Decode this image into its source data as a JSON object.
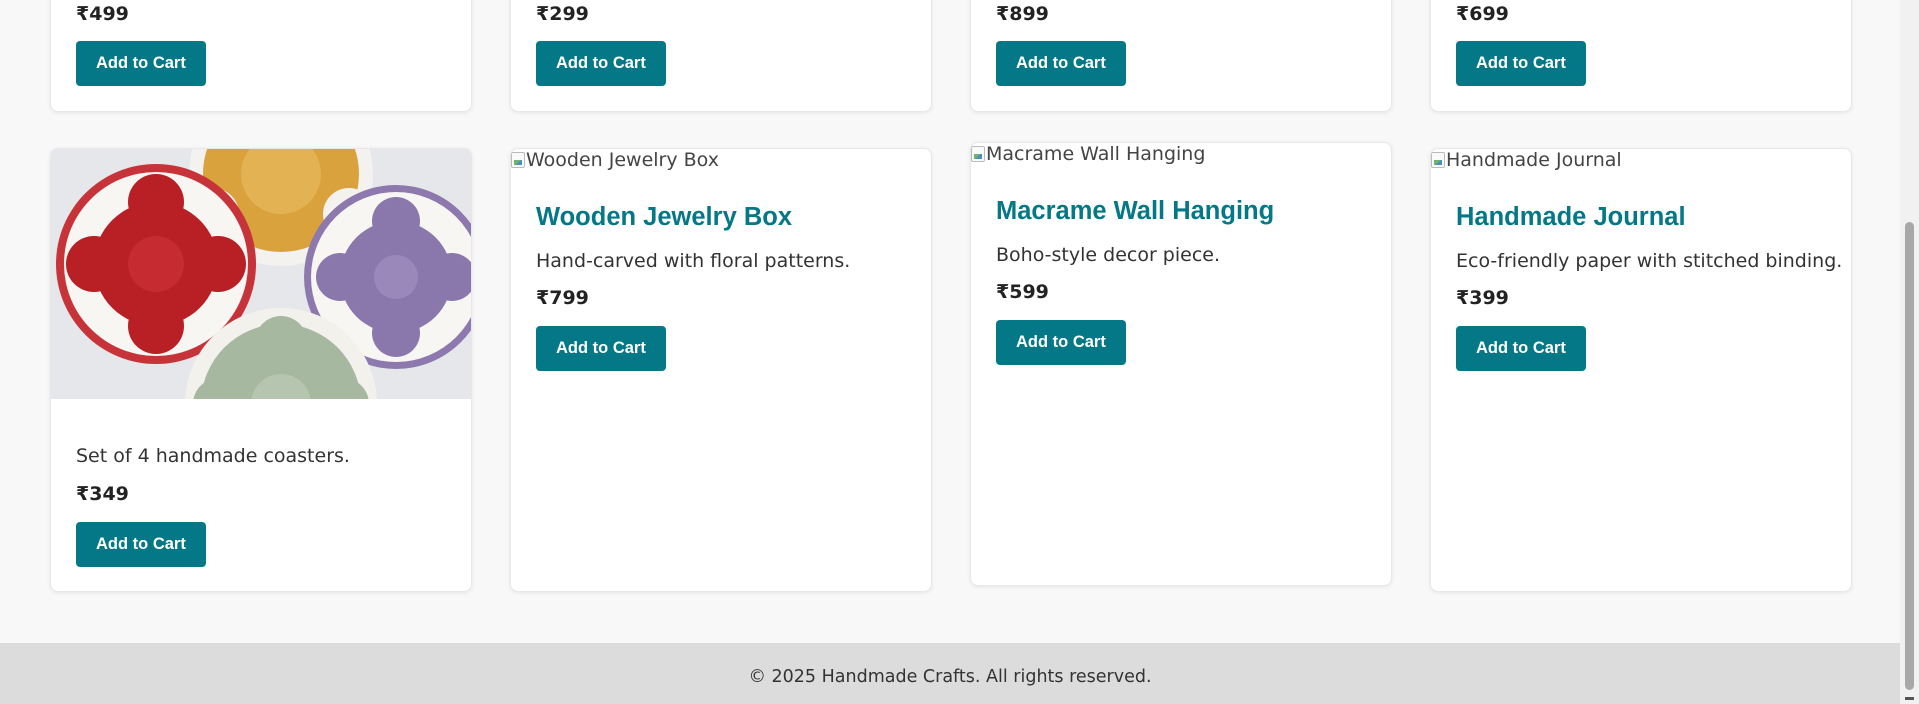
{
  "top_row": [
    {
      "price": "₹499",
      "button": "Add to Cart"
    },
    {
      "price": "₹299",
      "button": "Add to Cart"
    },
    {
      "price": "₹899",
      "button": "Add to Cart"
    },
    {
      "price": "₹699",
      "button": "Add to Cart"
    }
  ],
  "products": [
    {
      "image_alt": "Crochet coasters",
      "description": "Set of 4 handmade coasters.",
      "price": "₹349",
      "button": "Add to Cart"
    },
    {
      "image_alt": "Wooden Jewelry Box",
      "title": "Wooden Jewelry Box",
      "description": "Hand-carved with floral patterns.",
      "price": "₹799",
      "button": "Add to Cart"
    },
    {
      "image_alt": "Macrame Wall Hanging",
      "title": "Macrame Wall Hanging",
      "description": "Boho-style decor piece.",
      "price": "₹599",
      "button": "Add to Cart"
    },
    {
      "image_alt": "Handmade Journal",
      "title": "Handmade Journal",
      "description": "Eco-friendly paper with stitched binding.",
      "price": "₹399",
      "button": "Add to Cart"
    }
  ],
  "footer": {
    "copyright": "© 2025 Handmade Crafts. All rights reserved."
  },
  "colors": {
    "accent": "#047886",
    "background": "#f8f8f8",
    "footer_bg": "#dcdcdc"
  }
}
